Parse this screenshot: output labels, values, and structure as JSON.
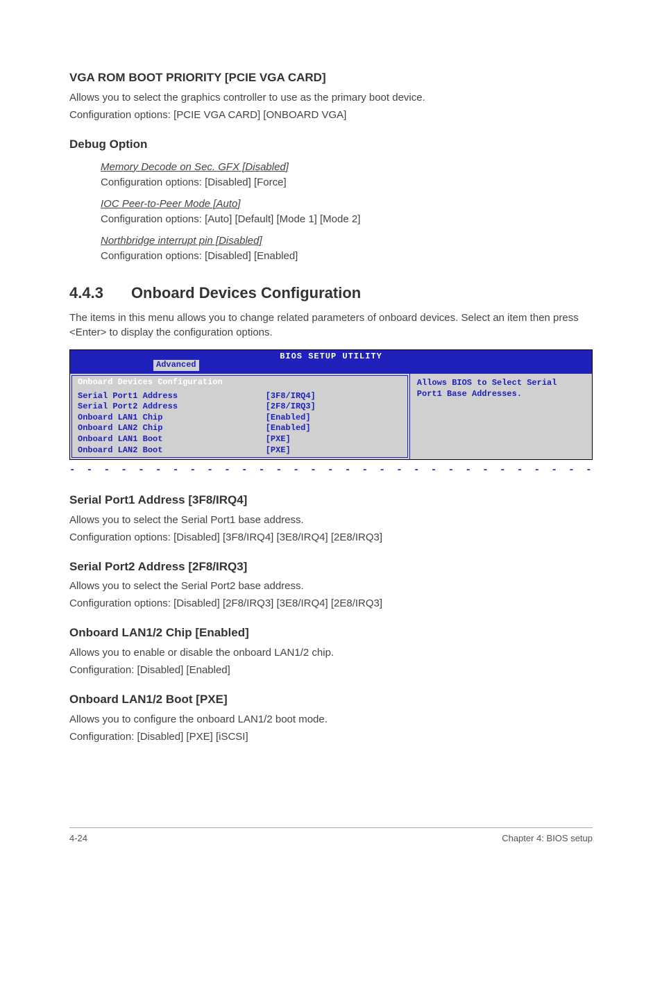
{
  "s1": {
    "title": "VGA ROM BOOT PRIORITY [PCIE VGA CARD]",
    "p1": "Allows you to select the graphics controller to use as the primary boot device.",
    "p2": "Configuration options: [PCIE VGA CARD] [ONBOARD VGA]"
  },
  "s2": {
    "title": "Debug Option",
    "items": [
      {
        "head": "Memory Decode on Sec. GFX [Disabled]",
        "conf": "Configuration options: [Disabled] [Force]"
      },
      {
        "head": "IOC Peer-to-Peer Mode [Auto]",
        "conf": "Configuration options: [Auto] [Default] [Mode 1] [Mode 2]"
      },
      {
        "head": "Northbridge interrupt pin [Disabled]",
        "conf": "Configuration options: [Disabled] [Enabled]"
      }
    ]
  },
  "s3": {
    "num": "4.4.3",
    "title": "Onboard Devices Configuration",
    "p1": "The items in this menu allows you to change related parameters of onboard devices. Select an item then press <Enter> to display the configuration options."
  },
  "bios": {
    "title": "BIOS SETUP UTILITY",
    "tab": "Advanced",
    "panelTitle": "Onboard Devices Configuration",
    "rows": [
      {
        "label": "Serial Port1 Address",
        "value": "[3F8/IRQ4]"
      },
      {
        "label": "Serial Port2 Address",
        "value": "[2F8/IRQ3]"
      },
      {
        "label": "Onboard LAN1 Chip",
        "value": "[Enabled]"
      },
      {
        "label": "Onboard LAN2 Chip",
        "value": "[Enabled]"
      },
      {
        "label": "Onboard LAN1 Boot",
        "value": "[PXE]"
      },
      {
        "label": "Onboard LAN2 Boot",
        "value": "[PXE]"
      }
    ],
    "help": "Allows BIOS to Select Serial Port1 Base Addresses."
  },
  "s4": {
    "title": "Serial Port1 Address [3F8/IRQ4]",
    "p1": "Allows you to select the Serial Port1 base address.",
    "p2": "Configuration options: [Disabled] [3F8/IRQ4] [3E8/IRQ4] [2E8/IRQ3]"
  },
  "s5": {
    "title": "Serial Port2 Address [2F8/IRQ3]",
    "p1": "Allows you to select the Serial Port2 base address.",
    "p2": "Configuration options: [Disabled] [2F8/IRQ3] [3E8/IRQ4] [2E8/IRQ3]"
  },
  "s6": {
    "title": "Onboard LAN1/2 Chip [Enabled]",
    "p1": "Allows you to enable or disable the onboard LAN1/2 chip.",
    "p2": "Configuration: [Disabled] [Enabled]"
  },
  "s7": {
    "title": "Onboard LAN1/2 Boot [PXE]",
    "p1": "Allows you to configure the onboard LAN1/2 boot mode.",
    "p2": "Configuration: [Disabled] [PXE] [iSCSI]"
  },
  "footer": {
    "left": "4-24",
    "right": "Chapter 4: BIOS setup"
  },
  "dashes": "- - - - - - - - - - - - - - - - - - - - - - - - - - - - - - - - - - - - - - - -"
}
